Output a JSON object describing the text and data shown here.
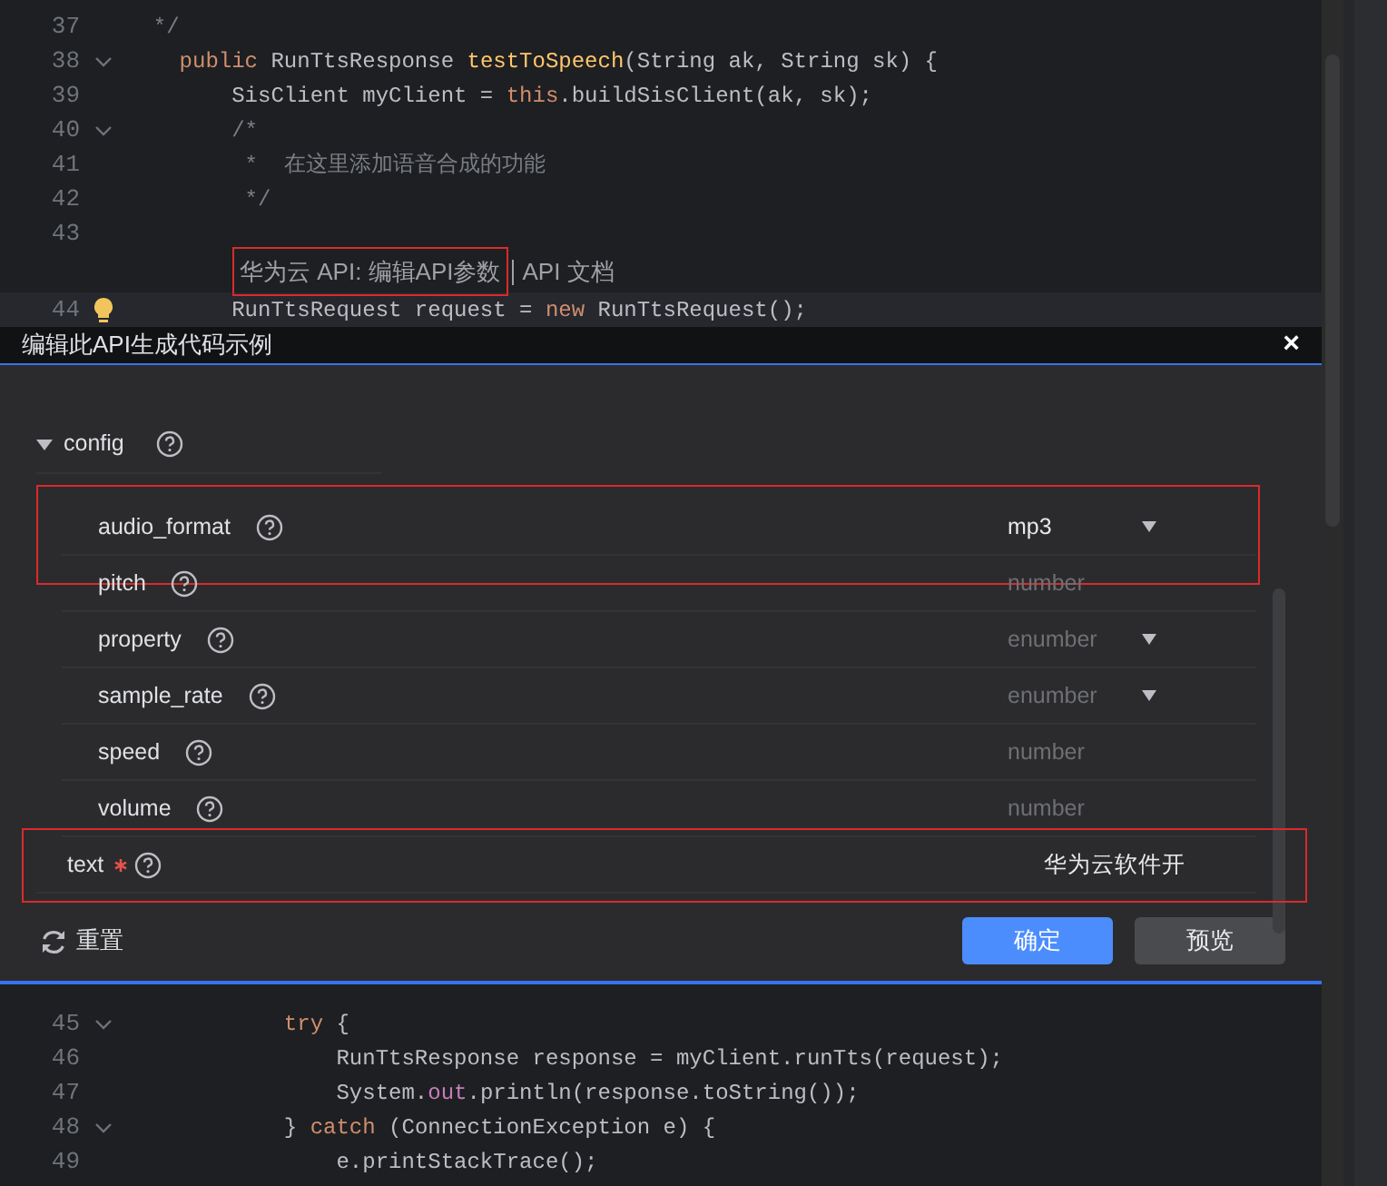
{
  "code_top": [
    {
      "number": "37",
      "fold": false,
      "tokens": [
        {
          "kind": "comment",
          "t": "  */"
        }
      ]
    },
    {
      "number": "38",
      "fold": true,
      "tokens": [
        {
          "kind": "keyword",
          "t": "    public "
        },
        {
          "kind": "plain",
          "t": "RunTtsResponse "
        },
        {
          "kind": "function",
          "t": "testToSpeech"
        },
        {
          "kind": "plain",
          "t": "(String ak, String sk) {"
        }
      ]
    },
    {
      "number": "39",
      "fold": false,
      "tokens": [
        {
          "kind": "plain",
          "t": "        SisClient myClient = "
        },
        {
          "kind": "keyword",
          "t": "this"
        },
        {
          "kind": "plain",
          "t": ".buildSisClient(ak, sk);"
        }
      ]
    },
    {
      "number": "40",
      "fold": true,
      "tokens": [
        {
          "kind": "comment",
          "t": "        /*"
        }
      ]
    },
    {
      "number": "41",
      "fold": false,
      "tokens": [
        {
          "kind": "comment",
          "t": "         *  在这里添加语音合成的功能"
        }
      ]
    },
    {
      "number": "42",
      "fold": false,
      "tokens": [
        {
          "kind": "comment",
          "t": "         */"
        }
      ]
    },
    {
      "number": "43",
      "fold": false
    }
  ],
  "codelens": {
    "parts": [
      {
        "text": "华为云 API: 编辑API参数",
        "highlighted": true
      },
      {
        "text": "API 文档",
        "highlighted": false
      }
    ]
  },
  "code_mid": [
    {
      "number": "44",
      "fold": false,
      "bulb": true,
      "tokens": [
        {
          "kind": "plain",
          "t": "        RunTtsRequest request = "
        },
        {
          "kind": "keyword",
          "t": "new "
        },
        {
          "kind": "plain",
          "t": "RunTtsRequest();"
        }
      ]
    }
  ],
  "dialog": {
    "title": "编辑此API生成代码示例",
    "close": "×",
    "group": {
      "name": "config",
      "expanded": true
    },
    "params": [
      {
        "name": "audio_format",
        "kind": "select",
        "value": "mp3",
        "highlighted": true,
        "required": false,
        "nested": true
      },
      {
        "name": "pitch",
        "kind": "input",
        "placeholder": "number",
        "highlighted": false,
        "required": false,
        "nested": true
      },
      {
        "name": "property",
        "kind": "select",
        "placeholder": "enumber",
        "highlighted": false,
        "required": false,
        "nested": true
      },
      {
        "name": "sample_rate",
        "kind": "select",
        "placeholder": "enumber",
        "highlighted": false,
        "required": false,
        "nested": true
      },
      {
        "name": "speed",
        "kind": "input",
        "placeholder": "number",
        "highlighted": false,
        "required": false,
        "nested": true
      },
      {
        "name": "volume",
        "kind": "input",
        "placeholder": "number",
        "highlighted": false,
        "required": false,
        "nested": true
      },
      {
        "name": "text",
        "kind": "input",
        "value": "华为云软件开",
        "highlighted": true,
        "required": true,
        "nested": false
      }
    ],
    "reset": "重置",
    "buttons": [
      {
        "label": "确定",
        "primary": true
      },
      {
        "label": "预览",
        "primary": false
      }
    ]
  },
  "code_bottom": [
    {
      "number": "45",
      "fold": true,
      "tokens": [
        {
          "kind": "keyword",
          "t": "            try "
        },
        {
          "kind": "plain",
          "t": "{"
        }
      ]
    },
    {
      "number": "46",
      "fold": false,
      "tokens": [
        {
          "kind": "plain",
          "t": "                RunTtsResponse response = myClient.runTts(request);"
        }
      ]
    },
    {
      "number": "47",
      "fold": false,
      "tokens": [
        {
          "kind": "plain",
          "t": "                System."
        },
        {
          "kind": "field",
          "t": "out"
        },
        {
          "kind": "plain",
          "t": ".println(response.toString());"
        }
      ]
    },
    {
      "number": "48",
      "fold": true,
      "tokens": [
        {
          "kind": "plain",
          "t": "            } "
        },
        {
          "kind": "keyword",
          "t": "catch "
        },
        {
          "kind": "plain",
          "t": "(ConnectionException e) {"
        }
      ]
    },
    {
      "number": "49",
      "fold": false,
      "tokens": [
        {
          "kind": "plain",
          "t": "                e.printStackTrace();"
        }
      ]
    }
  ]
}
